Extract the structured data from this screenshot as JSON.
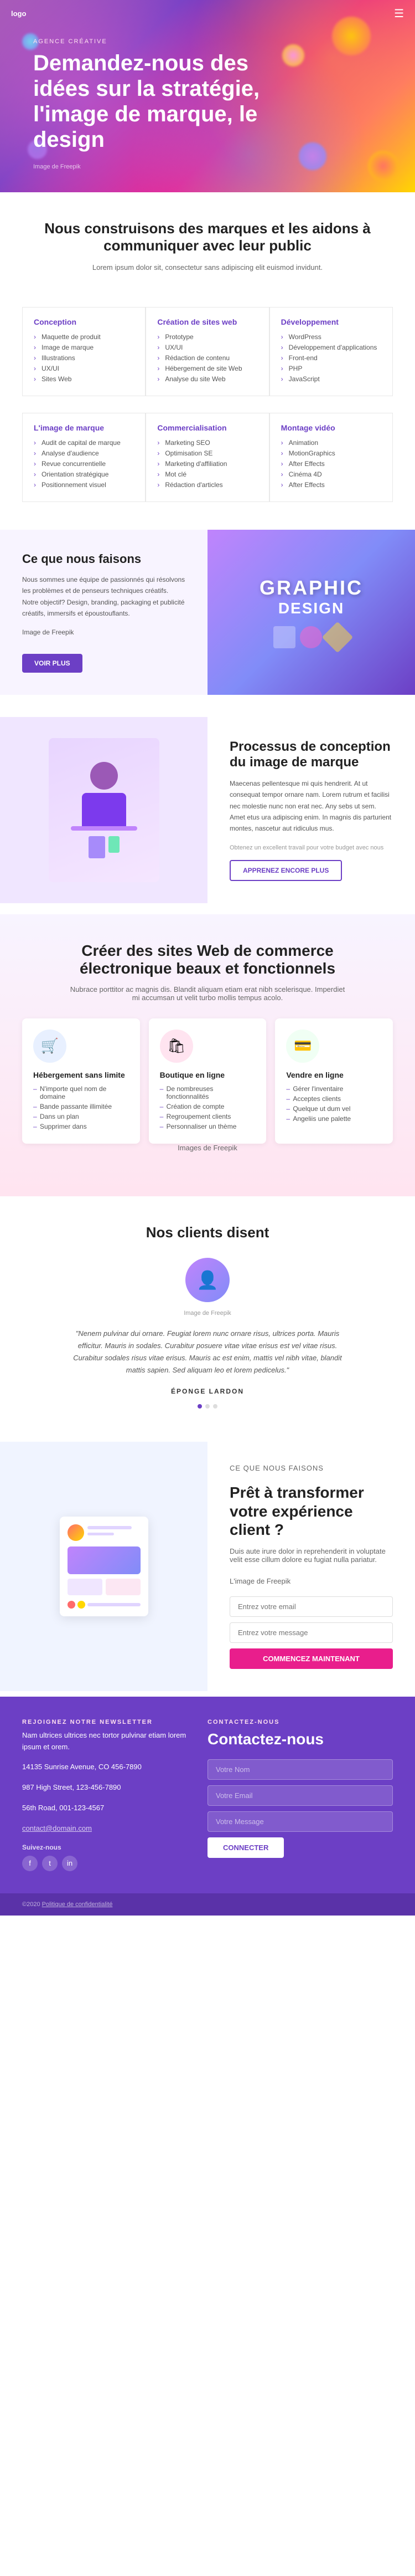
{
  "header": {
    "logo": "logo",
    "agency_label": "AGENCE CRÉATIVE",
    "title": "Demandez-nous des idées sur la stratégie, l'image de marque, le design",
    "image_label": "Image de Freepik"
  },
  "intro": {
    "title": "Nous construisons des marques et les aidons à communiquer avec leur public",
    "text": "Lorem ipsum dolor sit, consectetur sans adipiscing elit euismod invidunt."
  },
  "services": {
    "row1": [
      {
        "title": "Conception",
        "items": [
          "Maquette de produit",
          "Image de marque",
          "Illustrations",
          "UX/UI",
          "Sites Web"
        ]
      },
      {
        "title": "Création de sites web",
        "items": [
          "Prototype",
          "UX/UI",
          "Rédaction de contenu",
          "Hébergement de site Web",
          "Analyse du site Web"
        ]
      },
      {
        "title": "Développement",
        "items": [
          "WordPress",
          "Développement d'applications",
          "Front-end",
          "PHP",
          "JavaScript"
        ]
      }
    ],
    "row2": [
      {
        "title": "L'image de marque",
        "items": [
          "Audit de capital de marque",
          "Analyse d'audience",
          "Revue concurrentielle",
          "Orientation stratégique",
          "Positionnement visuel"
        ]
      },
      {
        "title": "Commercialisation",
        "items": [
          "Marketing SEO",
          "Optimisation SE",
          "Marketing d'affiliation",
          "Mot clé",
          "Rédaction d'articles"
        ]
      },
      {
        "title": "Montage vidéo",
        "items": [
          "Animation",
          "MotionGraphics",
          "After Effects",
          "Cinéma 4D",
          "After Effects"
        ]
      }
    ]
  },
  "what_we_do": {
    "title": "Ce que nous faisons",
    "text": "Nous sommes une équipe de passionnés qui résolvons les problèmes et de penseurs techniques créatifs. Notre objectif? Design, branding, packaging et publicité créatifs, immersifs et époustouflants.",
    "image_label": "Image de Freepik",
    "button": "VOIR PLUS",
    "graphic_text": "GRAPHIC DESIGN"
  },
  "brand_process": {
    "title": "Processus de conception du image de marque",
    "text": "Maecenas pellentesque mi quis hendrerit. At ut consequat tempor ornare nam. Lorem rutrum et facilisi nec molestie nunc non erat nec. Any sebs ut sem. Amet etus ura adipiscing enim. In magnis dis parturient montes, nascetur aut ridiculus mus.",
    "budget_text": "Obtenez un excellent travail pour votre budget avec nous",
    "image_label": "",
    "button": "APPRENEZ ENCORE PLUS"
  },
  "ecommerce": {
    "title": "Créer des sites Web de commerce électronique beaux et fonctionnels",
    "text": "Nubrace porttitor ac magnis dis. Blandit aliquam etiam erat nibh scelerisque. Imperdiet mi accumsan ut velit turbo mollis tempus acolo.",
    "cards": [
      {
        "icon": "🛒",
        "icon_bg": "#e8f0ff",
        "title": "Hébergement sans limite",
        "items": [
          "N'importe quel nom de domaine",
          "Bande passante illimitée",
          "Dans un plan",
          "Supprimer dans"
        ]
      },
      {
        "icon": "🛍",
        "icon_bg": "#ffe4f0",
        "title": "Boutique en ligne",
        "items": [
          "De nombreuses fonctionnalités",
          "Création de compte",
          "Regroupement clients",
          "Personnaliser un thème"
        ]
      },
      {
        "icon": "💳",
        "icon_bg": "#f0fff4",
        "title": "Vendre en ligne",
        "items": [
          "Gérer l'inventaire",
          "Acceptes clients",
          "Quelque ut dum vel",
          "Angeliis une palette"
        ]
      }
    ],
    "image_label": "Images de Freepik"
  },
  "testimonials": {
    "title": "Nos clients disent",
    "image_label": "Image de Freepik",
    "text": "\"Nenem pulvinar dui ornare. Feugiat lorem nunc ornare risus, ultrices porta. Mauris efficitur. Mauris in sodales. Curabitur posuere vitae vitae erisus est vel vitae risus. Curabitur sodales risus vitae erisus. Mauris ac est enim, mattis vel nibh vitae, blandit mattis sapien. Sed aliquam leo et lorem pedicelus.\"",
    "name": "ÉPONGE LARDON",
    "dots": [
      true,
      false,
      false
    ]
  },
  "cta_transform": {
    "label": "CE QUE NOUS FAISONS",
    "title": "Prêt à transformer votre expérience client ?",
    "text": "Duis aute irure dolor in reprehenderit in voluptate velit esse cillum dolore eu fugiat nulla pariatur.",
    "input_placeholder1": "Entrez votre email",
    "input_placeholder2": "Entrez votre message",
    "image_label": "L'image de Freepik",
    "button": "COMMENCEZ MAINTENANT"
  },
  "footer": {
    "newsletter_label": "REJOIGNEZ NOTRE NEWSLETTER",
    "newsletter_text": "Nam ultrices ultrices nec tortor pulvinar etiam lorem ipsum et orem.",
    "address": "14135 Sunrise Avenue, CO 456-7890\n987 High Street, 123-456-7890\n56th Road, 001-123-4567",
    "email": "contact@domain.com",
    "social_label": "Suivez-nous",
    "social_icons": [
      "f",
      "t",
      "in"
    ],
    "contact_label": "CONTACTEZ-NOUS",
    "contact_title": "Contactez-nous",
    "input1_placeholder": "Votre Nom",
    "input2_placeholder": "Votre Email",
    "input3_placeholder": "Votre Message",
    "button": "CONNECTER"
  },
  "bottom_footer": {
    "text": "©2020 Politique de confidentialité",
    "link": "Politique de confidentialité"
  }
}
